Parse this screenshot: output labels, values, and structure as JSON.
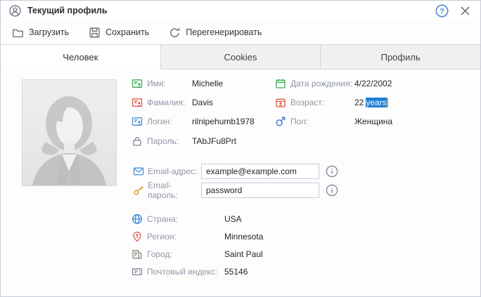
{
  "window": {
    "title": "Текущий профиль"
  },
  "titlebar_icons": {
    "help": "?",
    "close": "✕"
  },
  "toolbar": {
    "load_label": "Загрузить",
    "save_label": "Сохранить",
    "regenerate_label": "Перегенерировать"
  },
  "tabs": [
    {
      "label": "Человек",
      "active": true
    },
    {
      "label": "Cookies",
      "active": false
    },
    {
      "label": "Профиль",
      "active": false
    }
  ],
  "person": {
    "name": {
      "label": "Имя:",
      "value": "Michelle"
    },
    "surname": {
      "label": "Фамилия:",
      "value": "Davis"
    },
    "login": {
      "label": "Логин:",
      "value": "rilnipehumb1978"
    },
    "password": {
      "label": "Пароль:",
      "value": "TAbJFu8Prt"
    },
    "birthdate": {
      "label": "Дата рождения:",
      "value": "4/22/2002"
    },
    "age": {
      "label": "Возраст:",
      "value_plain": "22",
      "value_selected": "years"
    },
    "gender": {
      "label": "Пол:",
      "value": "Женщина"
    },
    "email": {
      "label": "Email-адрес:",
      "value": "example@example.com"
    },
    "email_password": {
      "label": "Email-пароль:",
      "value": "password"
    },
    "country": {
      "label": "Страна:",
      "value": "USA"
    },
    "region": {
      "label": "Регион:",
      "value": "Minnesota"
    },
    "city": {
      "label": "Город:",
      "value": "Saint Paul"
    },
    "postal": {
      "label": "Почтовый индекс:",
      "value": "55146"
    }
  },
  "colors": {
    "selection": "#1a7fd4",
    "accent_green": "#3cab4e",
    "accent_red": "#e25a4a",
    "accent_blue": "#4a90d9",
    "accent_gold": "#d9a021",
    "icon_gray": "#7d8594",
    "help_blue": "#4a7fd6"
  }
}
